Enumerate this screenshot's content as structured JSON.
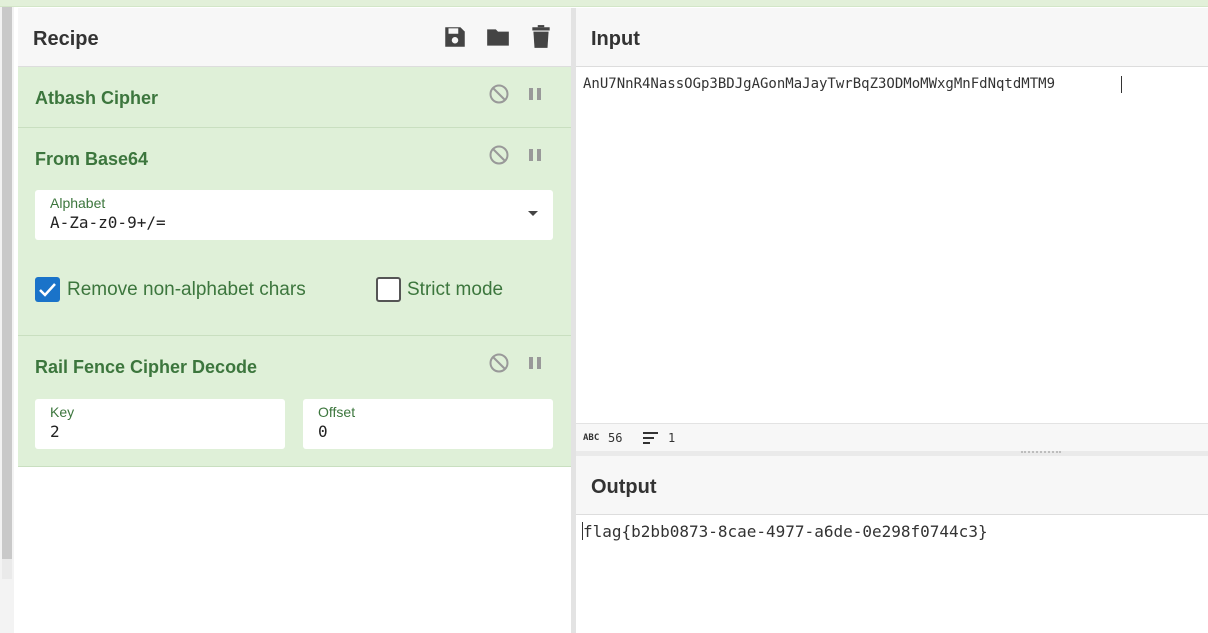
{
  "recipe": {
    "title": "Recipe",
    "icons": [
      "save-icon",
      "folder-icon",
      "trash-icon"
    ]
  },
  "operations": [
    {
      "title": "Atbash Cipher"
    },
    {
      "title": "From Base64",
      "alphabet_label": "Alphabet",
      "alphabet_value": "A-Za-z0-9+/=",
      "remove_label": "Remove non-alphabet chars",
      "remove_checked": true,
      "strict_label": "Strict mode",
      "strict_checked": false
    },
    {
      "title": "Rail Fence Cipher Decode",
      "key_label": "Key",
      "key_value": "2",
      "offset_label": "Offset",
      "offset_value": "0"
    }
  ],
  "input": {
    "title": "Input",
    "value": "AnU7NnR4NassOGp3BDJgAGonMaJayTwrBqZ3ODMoMWxgMnFdNqtdMTM9",
    "chars_count": "56",
    "lines_count": "1"
  },
  "output": {
    "title": "Output",
    "value": "flag{b2bb0873-8cae-4977-a6de-0e298f0744c3}"
  },
  "colors": {
    "op_background": "#dff0d8",
    "op_text": "#3c763d",
    "checkbox_on": "#1a73c9"
  }
}
